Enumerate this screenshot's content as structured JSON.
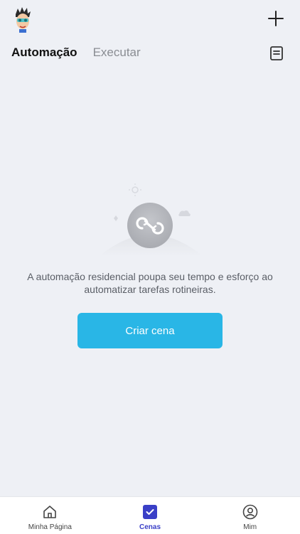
{
  "header": {
    "avatar_icon": "user-avatar",
    "add_icon": "plus-icon",
    "log_icon": "document-log-icon"
  },
  "tabs": [
    {
      "label": "Automação",
      "active": true
    },
    {
      "label": "Executar",
      "active": false
    }
  ],
  "empty_state": {
    "icon": "automation-loop-icon",
    "message": "A automação residencial poupa seu tempo e esforço ao automatizar tarefas rotineiras.",
    "button_label": "Criar cena"
  },
  "tab_bar": {
    "items": [
      {
        "label": "Minha Página",
        "icon": "home-icon",
        "active": false
      },
      {
        "label": "Cenas",
        "icon": "check-square-icon",
        "active": true
      },
      {
        "label": "Mim",
        "icon": "user-circle-icon",
        "active": false
      }
    ]
  },
  "colors": {
    "background": "#eef0f5",
    "accent_button": "#29b6e6",
    "active_tab": "#3a3fc7"
  }
}
